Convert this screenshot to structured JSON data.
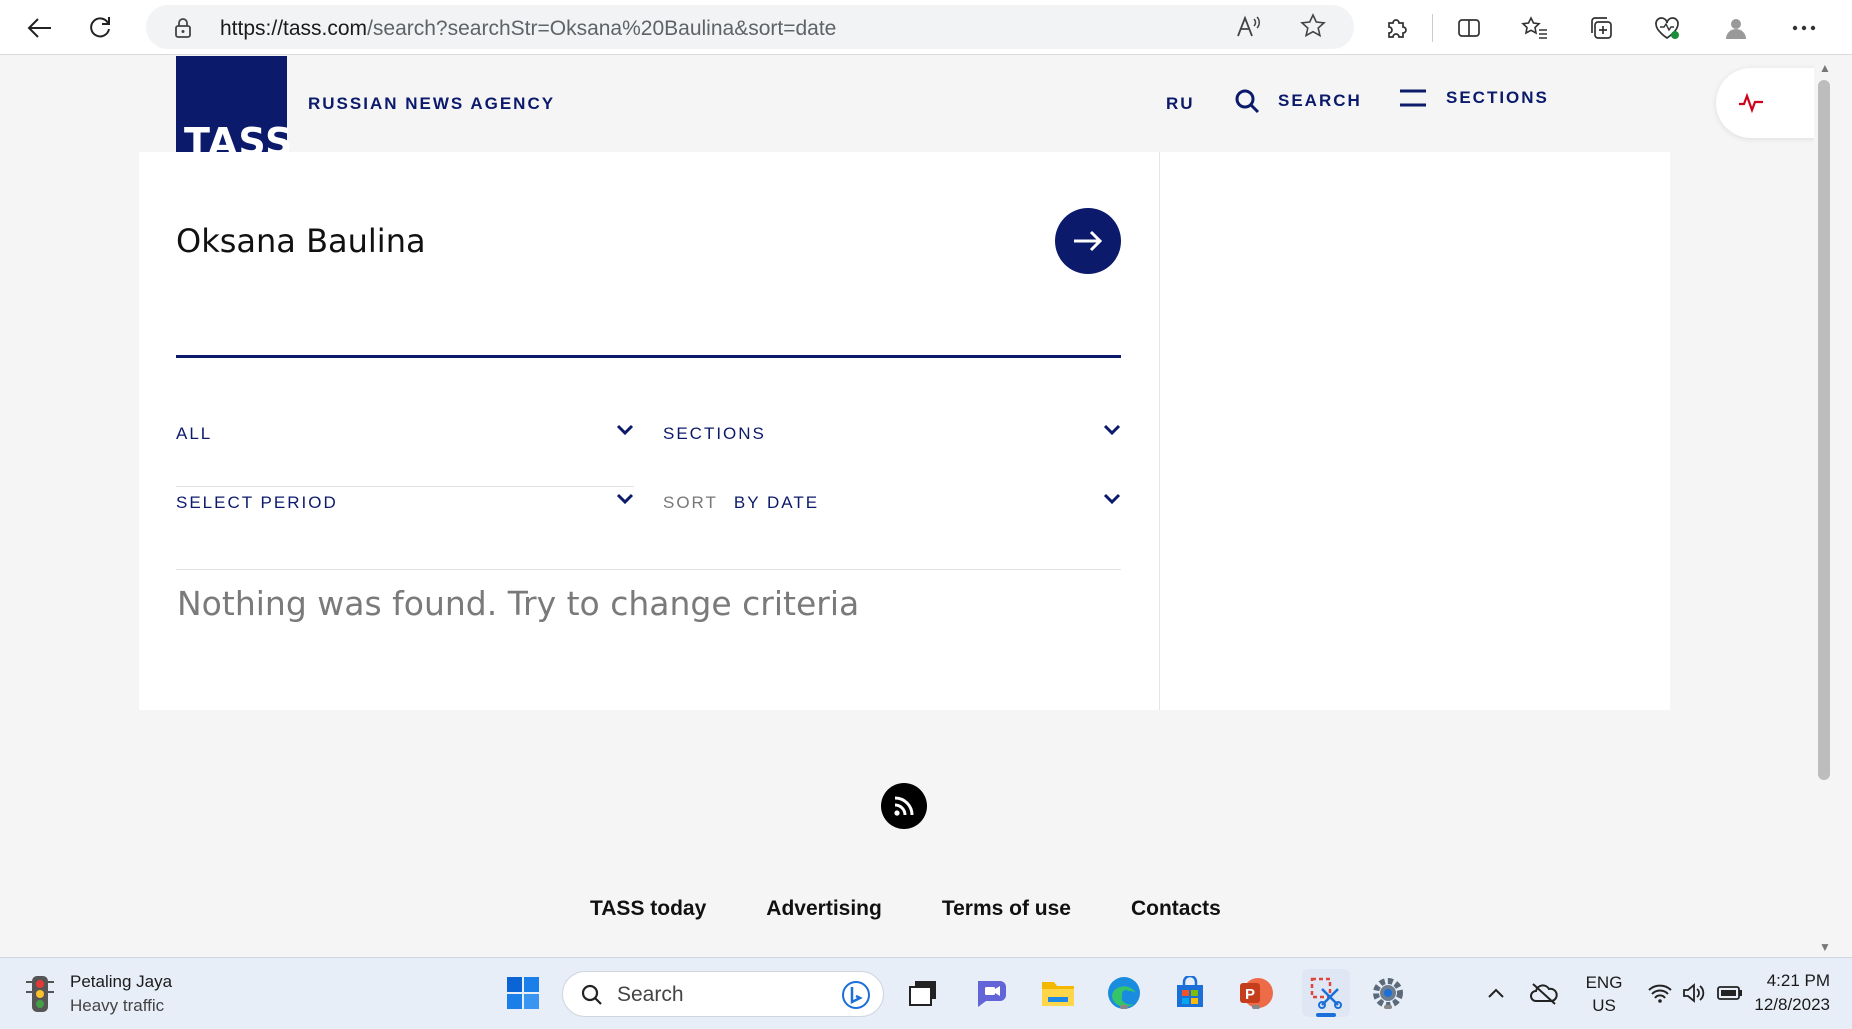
{
  "browser": {
    "url_host": "https://tass.com",
    "url_path": "/search?searchStr=Oksana%20Baulina&sort=date",
    "read_aloud": "A)"
  },
  "site": {
    "logo_text": "TASS",
    "agency_name": "RUSSIAN NEWS AGENCY",
    "nav": {
      "lang": "RU",
      "search": "SEARCH",
      "sections": "SECTIONS"
    }
  },
  "search": {
    "query": "Oksana Baulina",
    "filters": {
      "type": "ALL",
      "sections": "SECTIONS",
      "period": "SELECT PERIOD",
      "sort_label": "SORT",
      "sort_value": "BY DATE"
    },
    "empty_message": "Nothing was found. Try to change criteria"
  },
  "footer": {
    "links": [
      "TASS today",
      "Advertising",
      "Terms of use",
      "Contacts"
    ]
  },
  "taskbar": {
    "weather_location": "Petaling Jaya",
    "weather_status": "Heavy traffic",
    "search_placeholder": "Search",
    "lang_top": "ENG",
    "lang_bottom": "US",
    "time": "4:21 PM",
    "date": "12/8/2023"
  },
  "colors": {
    "brand": "#0b1a6b",
    "pulse": "#d0021b"
  }
}
